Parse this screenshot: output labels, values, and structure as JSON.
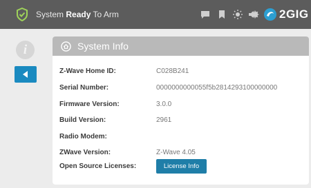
{
  "topbar": {
    "status_prefix": "System",
    "status_bold": "Ready",
    "status_suffix": "To Arm",
    "brand": "2GIG",
    "icons": [
      "shield-check-icon",
      "message-icon",
      "bookmark-icon",
      "brightness-icon",
      "volume-icon",
      "settings-icon"
    ]
  },
  "sidebar": {
    "info_glyph": "i"
  },
  "card": {
    "title": "System Info",
    "rows": [
      {
        "label": "Z-Wave Home ID:",
        "value": "C028B241"
      },
      {
        "label": "Serial Number:",
        "value": "0000000000055f5b2814293100000000"
      },
      {
        "label": "Firmware Version:",
        "value": "3.0.0"
      },
      {
        "label": "Build Version:",
        "value": "2961"
      },
      {
        "label": "Radio Modem:",
        "value": ""
      },
      {
        "label": "ZWave Version:",
        "value": "Z-Wave 4.05"
      },
      {
        "label": "Open Source Licenses:",
        "value": ""
      }
    ],
    "license_button": "License Info"
  },
  "colors": {
    "topbar": "#5c5c5c",
    "accent": "#1a8ac0",
    "shield": "#9fd35a",
    "card_header": "#b9b9b9"
  }
}
